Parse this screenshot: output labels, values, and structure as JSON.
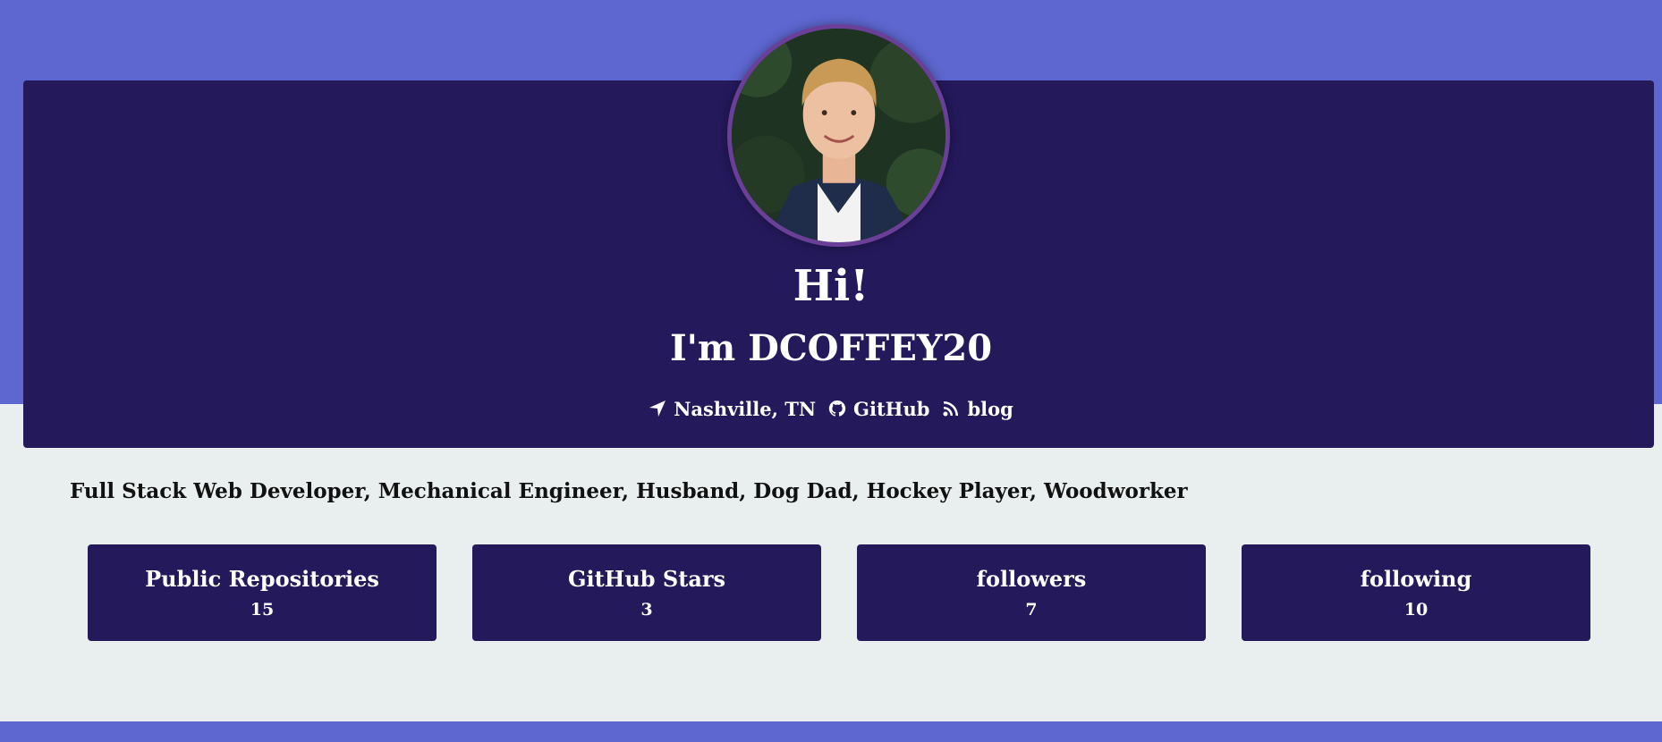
{
  "header": {
    "greeting": "Hi!",
    "intro": "I'm DCOFFEY20"
  },
  "links": [
    {
      "icon": "location-arrow-icon",
      "label": "Nashville, TN"
    },
    {
      "icon": "github-icon",
      "label": "GitHub"
    },
    {
      "icon": "rss-icon",
      "label": "blog"
    }
  ],
  "bio": "Full Stack Web Developer, Mechanical Engineer, Husband, Dog Dad, Hockey Player, Woodworker",
  "stats": [
    {
      "label": "Public Repositories",
      "value": "15"
    },
    {
      "label": "GitHub Stars",
      "value": "3"
    },
    {
      "label": "followers",
      "value": "7"
    },
    {
      "label": "following",
      "value": "10"
    }
  ],
  "colors": {
    "page_band": "#5e67d0",
    "card": "#24195b",
    "page_background": "#e9eeee",
    "avatar_border": "#6a3f98"
  }
}
